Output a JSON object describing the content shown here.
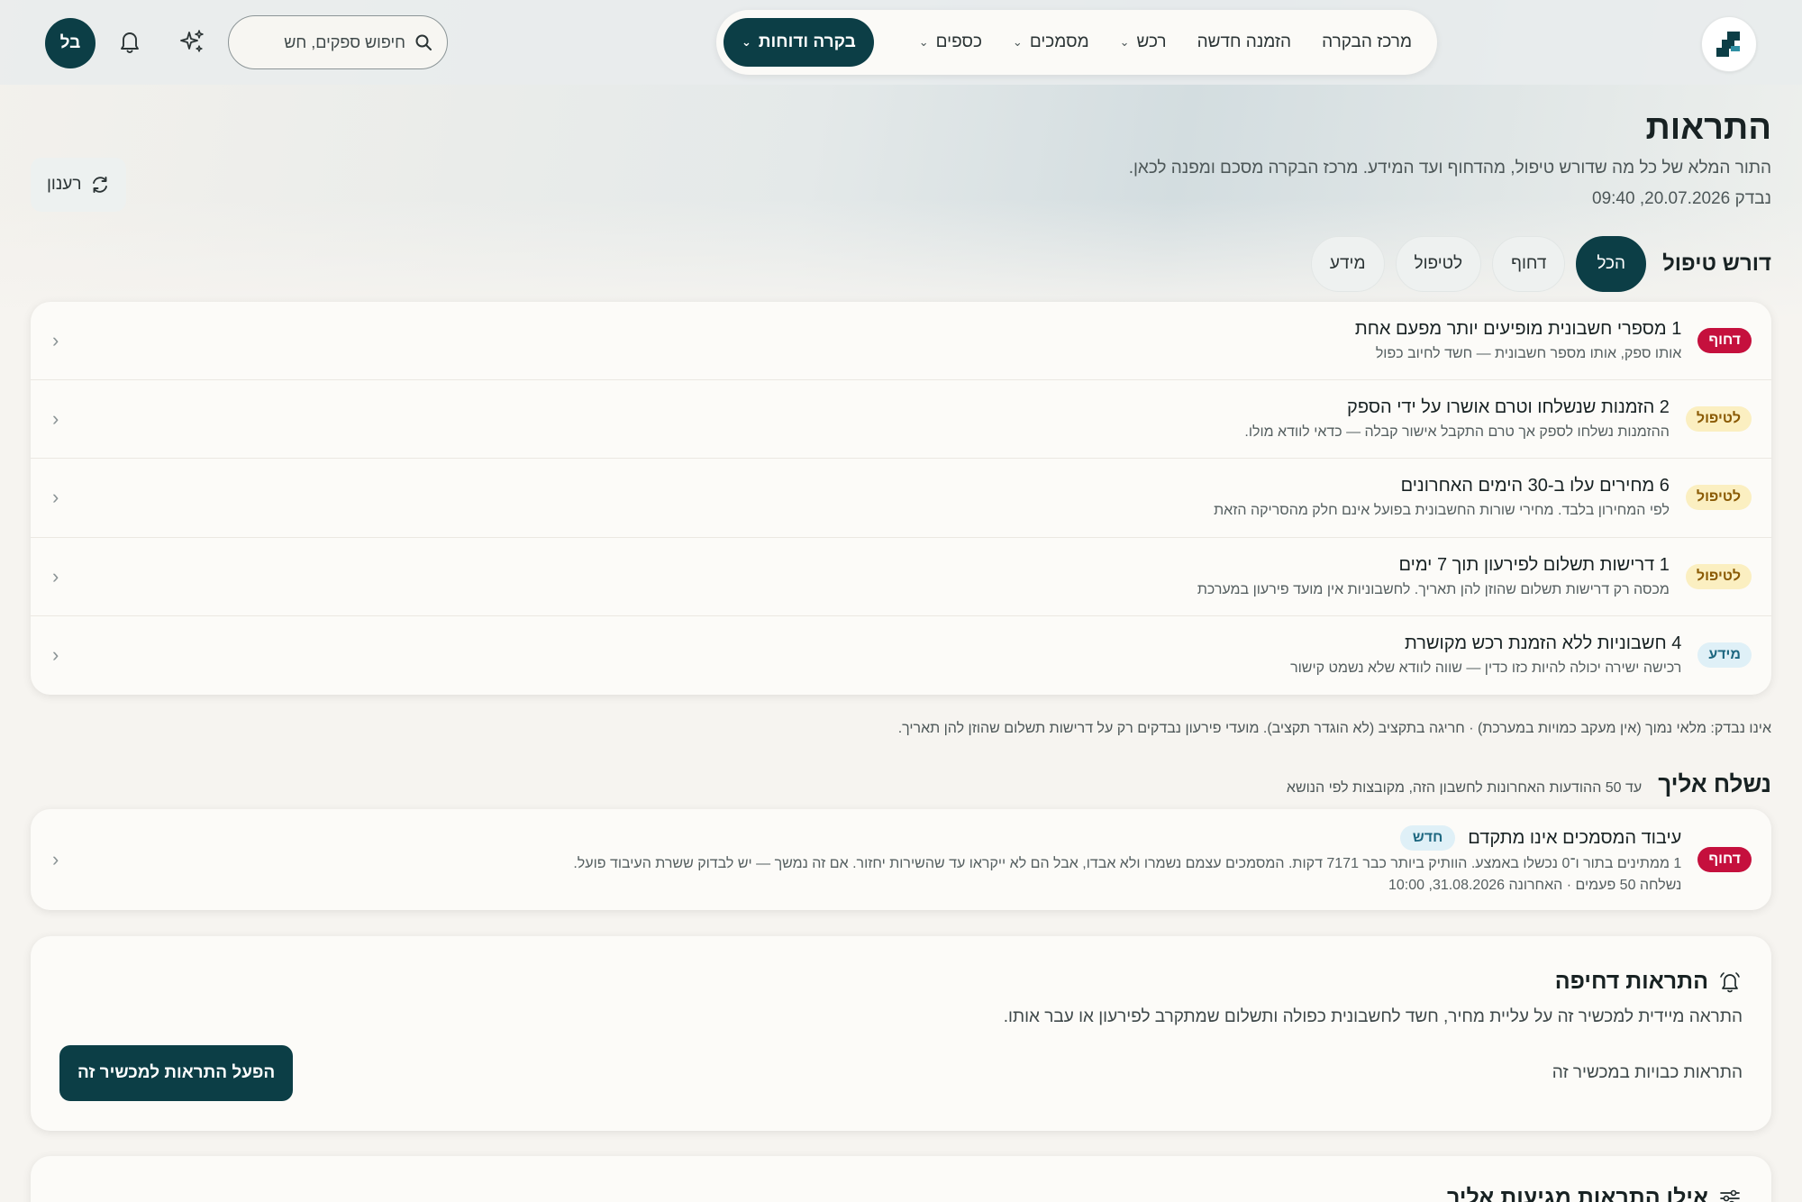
{
  "nav": {
    "items": [
      {
        "label": "מרכז הבקרה",
        "dropdown": false
      },
      {
        "label": "הזמנה חדשה",
        "dropdown": false
      },
      {
        "label": "רכש",
        "dropdown": true
      },
      {
        "label": "מסמכים",
        "dropdown": true
      },
      {
        "label": "כספים",
        "dropdown": true
      },
      {
        "label": "בקרה ודוחות",
        "dropdown": true,
        "active": true
      }
    ]
  },
  "search": {
    "placeholder": "חיפוש ספקים, חש"
  },
  "user": {
    "initials": "בל"
  },
  "header": {
    "title": "התראות",
    "subtitle": "התור המלא של כל מה שדורש טיפול, מהדחוף ועד המידע. מרכז הבקרה מסכם ומפנה לכאן.",
    "checked": "נבדק 20.07.2026, 09:40",
    "refresh_label": "רענון"
  },
  "filters": {
    "label": "דורש טיפול",
    "chips": [
      "הכל",
      "דחוף",
      "לטיפול",
      "מידע"
    ],
    "active": "הכל"
  },
  "alerts": [
    {
      "badge": "דחוף",
      "level": "urgent",
      "title": "1 מספרי חשבונית מופיעים יותר מפעם אחת",
      "desc": "אותו ספק, אותו מספר חשבונית — חשד לחיוב כפול"
    },
    {
      "badge": "לטיפול",
      "level": "handle",
      "title": "2 הזמנות שנשלחו וטרם אושרו על ידי הספק",
      "desc": "ההזמנות נשלחו לספק אך טרם התקבל אישור קבלה — כדאי לוודא מולו."
    },
    {
      "badge": "לטיפול",
      "level": "handle",
      "title": "6 מחירים עלו ב-30 הימים האחרונים",
      "desc": "לפי המחירון בלבד. מחירי שורות החשבונית בפועל אינם חלק מהסריקה הזאת"
    },
    {
      "badge": "לטיפול",
      "level": "handle",
      "title": "1 דרישות תשלום לפירעון תוך 7 ימים",
      "desc": "מכסה רק דרישות תשלום שהוזן להן תאריך. לחשבוניות אין מועד פירעון במערכת"
    },
    {
      "badge": "מידע",
      "level": "info",
      "title": "4 חשבוניות ללא הזמנת רכש מקושרת",
      "desc": "רכישה ישירה יכולה להיות כזו כדין — שווה לוודא שלא נשמט קישור"
    }
  ],
  "footnote": "אינו נבדק: מלאי נמוך (אין מעקב כמויות במערכת) · חריגה בתקציב (לא הוגדר תקציב). מועדי פירעון נבדקים רק על דרישות תשלום שהוזן להן תאריך.",
  "sent": {
    "title": "נשלח אליך",
    "subtitle": "עד 50 ההודעות האחרונות לחשבון הזה, מקובצות לפי הנושא",
    "items": [
      {
        "badge": "דחוף",
        "title": "עיבוד המסמכים אינו מתקדם",
        "new_label": "חדש",
        "desc": "1 ממתינים בתור ו־0 נכשלו באמצע. הוותיק ביותר כבר 7171 דקות. המסמכים עצמם נשמרו ולא אבדו, אבל הם לא ייקראו עד שהשירות יחזור. אם זה נמשך — יש לבדוק ששרת העיבוד פועל.",
        "meta": "נשלחה 50 פעמים · האחרונה 31.08.2026, 10:00"
      }
    ]
  },
  "push": {
    "title": "התראות דחיפה",
    "desc": "התראה מיידית למכשיר זה על עליית מחיר, חשד לחשבונית כפולה ותשלום שמתקרב לפירעון או עבר אותו.",
    "status": "התראות כבויות במכשיר זה",
    "button": "הפעל התראות למכשיר זה"
  },
  "rules": {
    "title": "אילו התראות מגיעות אליך"
  },
  "colors": {
    "brand": "#0c3e46",
    "urgent": "#c5103d",
    "handle_bg": "#fbefc1",
    "info_bg": "#dff0f7"
  },
  "icons": [
    "logo",
    "search-icon",
    "sparkles-icon",
    "bell-icon",
    "refresh-icon",
    "chevron-left-icon",
    "bell-ring-icon",
    "sliders-icon"
  ]
}
